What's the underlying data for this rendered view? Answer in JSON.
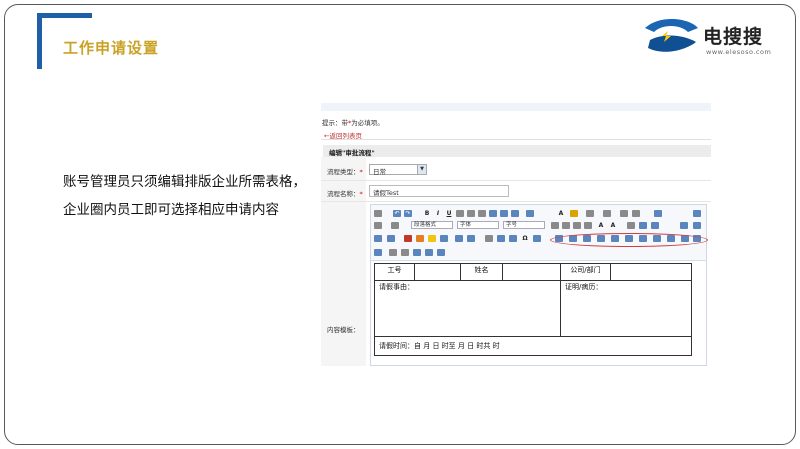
{
  "slide": {
    "title": "工作申请设置",
    "description": "账号管理员只须编辑排版企业所需表格，企业圈内员工即可选择相应申请内容",
    "logo": {
      "name": "电搜搜",
      "url_text": "www.elesoso.com"
    }
  },
  "screenshot": {
    "hint_prefix": "提示：带",
    "hint_star": "*",
    "hint_suffix": "为必填项。",
    "back_link": "←返回列表页",
    "section_title": "编辑\"审批流程\"",
    "fields": {
      "type_label": "流程类型：",
      "type_value": "日常",
      "name_label": "流程名称：",
      "name_value": "请假Test",
      "template_label": "内容模板：",
      "required_star": "*"
    },
    "editor": {
      "toolbar_combos": {
        "paragraph": "段落格式",
        "font": "字体",
        "size": "字号"
      },
      "form": {
        "emp_id": "工号",
        "name": "姓名",
        "dept": "公司/部门",
        "reason": "请假事由：",
        "proof": "证明/病历：",
        "time": "请假时间：自  月  日  时至  月  日  时共    时"
      }
    }
  },
  "colors": {
    "accent_blue": "#1f5fa8",
    "title_gold": "#c9a227",
    "highlight_red": "#d04040"
  }
}
